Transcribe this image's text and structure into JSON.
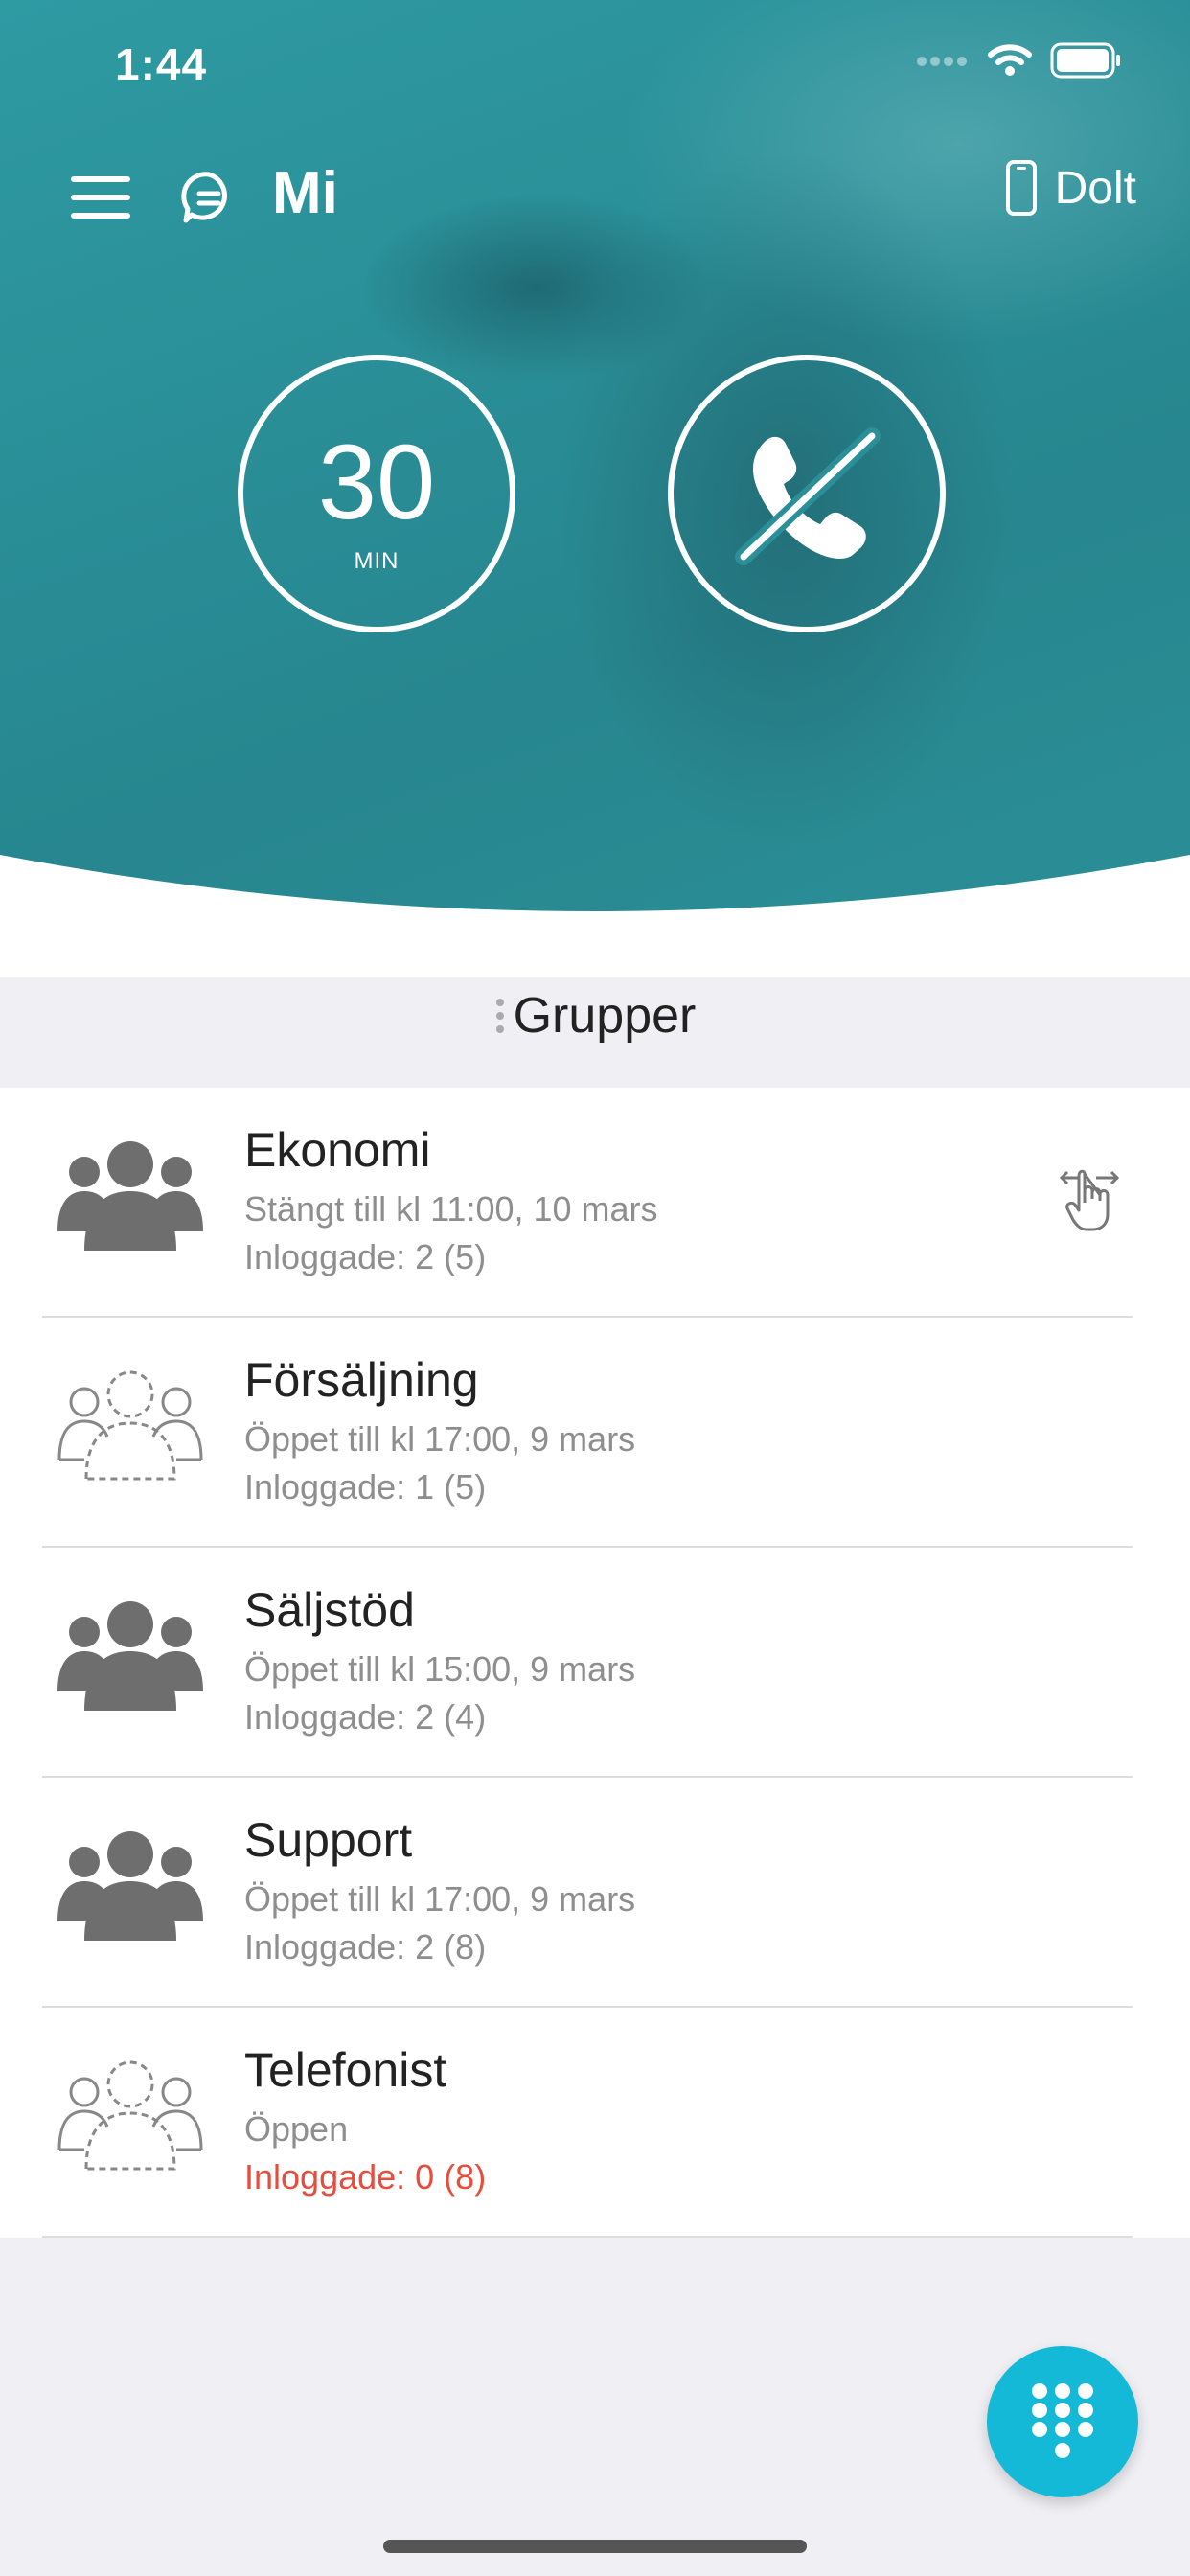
{
  "status_bar": {
    "time": "1:44"
  },
  "header": {
    "title": "Mi",
    "device_label": "Dolt"
  },
  "timer": {
    "value": "30",
    "unit": "MIN"
  },
  "groups": {
    "title": "Grupper",
    "items": [
      {
        "name": "Ekonomi",
        "status": "Stängt till kl 11:00, 10 mars",
        "logged_in": "Inloggade: 2 (5)",
        "joined": true,
        "alert": false
      },
      {
        "name": "Försäljning",
        "status": "Öppet till kl 17:00, 9 mars",
        "logged_in": "Inloggade: 1 (5)",
        "joined": false,
        "alert": false
      },
      {
        "name": "Säljstöd",
        "status": "Öppet till kl 15:00, 9 mars",
        "logged_in": "Inloggade: 2 (4)",
        "joined": true,
        "alert": false
      },
      {
        "name": "Support",
        "status": "Öppet till kl 17:00, 9 mars",
        "logged_in": "Inloggade: 2 (8)",
        "joined": true,
        "alert": false
      },
      {
        "name": "Telefonist",
        "status": "Öppen",
        "logged_in": "Inloggade: 0 (8)",
        "joined": false,
        "alert": true
      }
    ]
  },
  "colors": {
    "hero": "#2a8f98",
    "fab": "#13b9d6",
    "alert_text": "#e74c3c",
    "muted_text": "#8e8e8e",
    "group_icon": "#6e6e6e"
  },
  "icons": {
    "menu": "hamburger-icon",
    "chat": "chat-bubble-icon",
    "device": "phone-device-icon",
    "call": "call-disabled-icon",
    "swipe": "swipe-hand-icon",
    "dialpad": "dialpad-icon"
  }
}
